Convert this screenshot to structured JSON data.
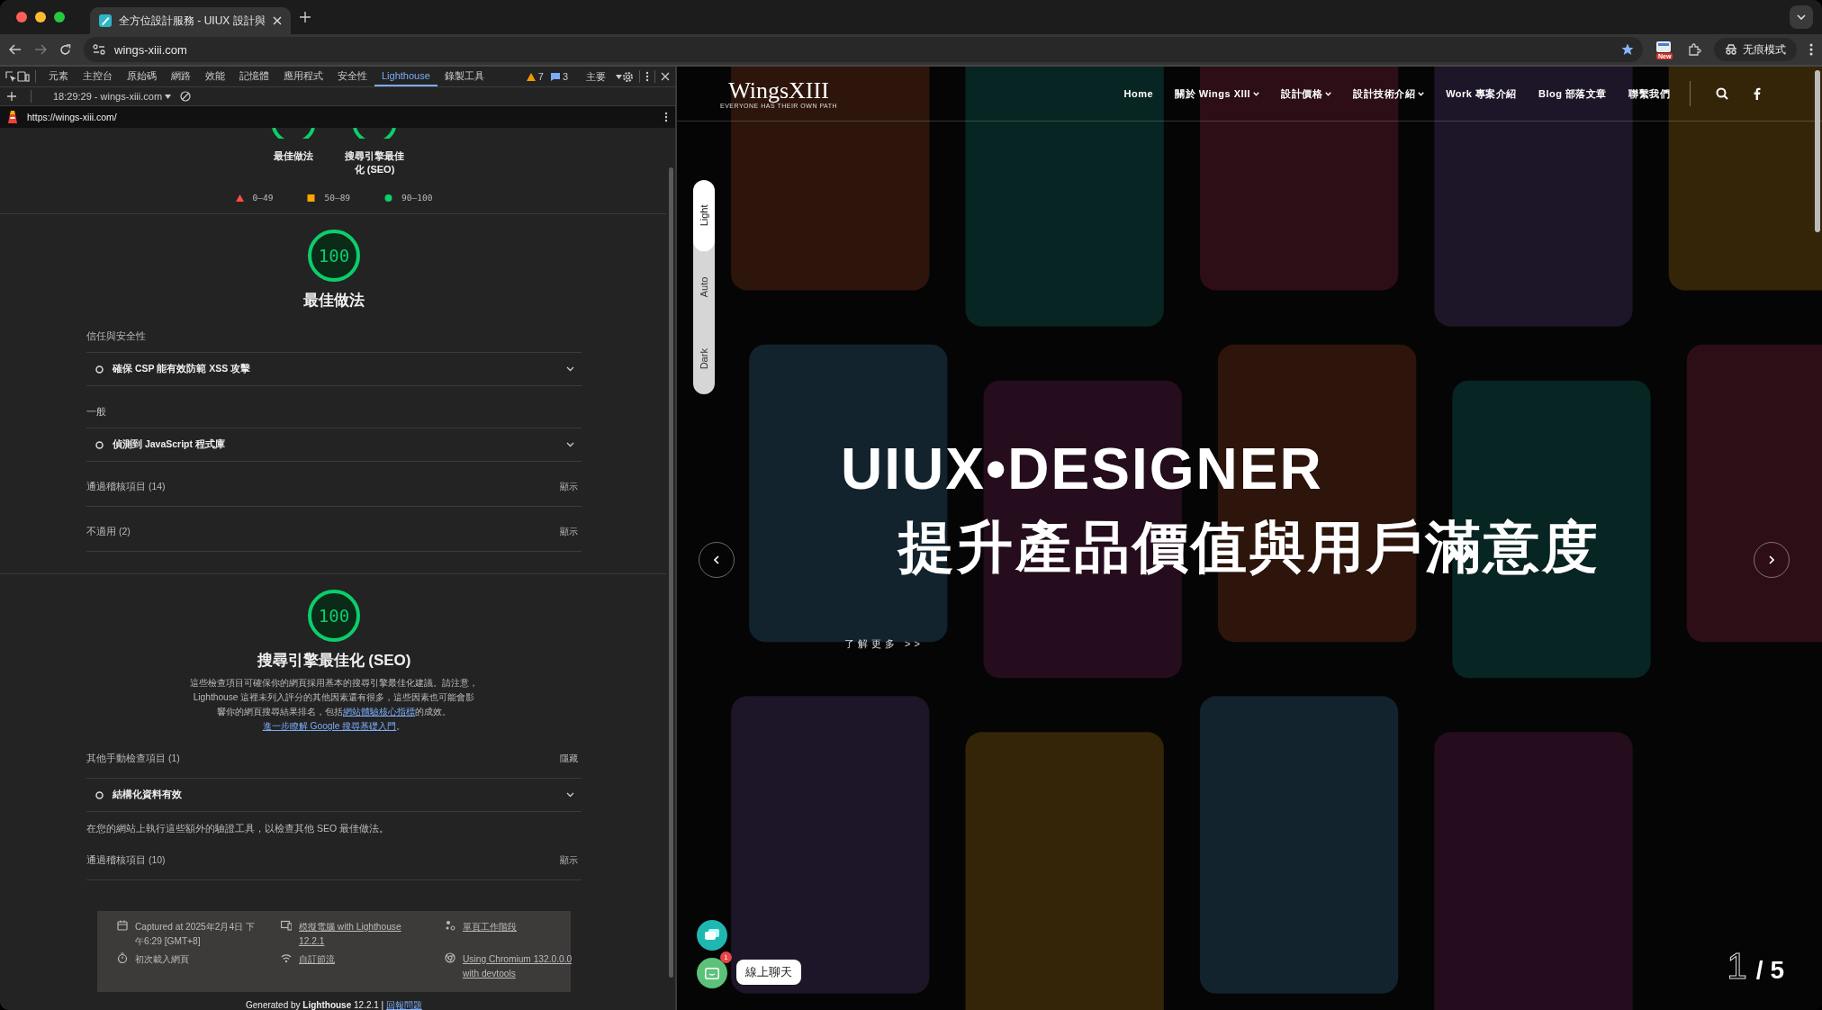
{
  "browser": {
    "tab": {
      "title": "全方位設計服務 - UIUX 設計與",
      "selected": true
    },
    "address": "wings-xiii.com",
    "extension_badge": "New",
    "profile": "无痕模式"
  },
  "devtools": {
    "tabs": [
      {
        "label": "元素",
        "selected": false
      },
      {
        "label": "主控台",
        "selected": false
      },
      {
        "label": "原始碼",
        "selected": false
      },
      {
        "label": "網路",
        "selected": false
      },
      {
        "label": "效能",
        "selected": false
      },
      {
        "label": "記憶體",
        "selected": false
      },
      {
        "label": "應用程式",
        "selected": false
      },
      {
        "label": "安全性",
        "selected": false
      },
      {
        "label": "Lighthouse",
        "selected": true
      },
      {
        "label": "錄製工具",
        "selected": false
      }
    ],
    "warnings": "7",
    "messages": "3",
    "context": "主要",
    "session": "18:29:29 - wings-xiii.com",
    "report_url": "https://wings-xiii.com/",
    "report": {
      "top_gauges": [
        {
          "label": "最佳做法"
        },
        {
          "label": "搜尋引擎最佳化 (SEO)"
        }
      ],
      "legend": [
        {
          "kind": "fail",
          "range": "0–49",
          "color": "#ff4e42"
        },
        {
          "kind": "average",
          "range": "50–89",
          "color": "#ffa400"
        },
        {
          "kind": "pass",
          "range": "90–100",
          "color": "#0cce6b"
        }
      ],
      "categories": [
        {
          "score": "100",
          "title": "最佳做法",
          "items": [
            {
              "kind": "group-title",
              "text": "信任與安全性"
            },
            {
              "kind": "audit",
              "text": "確保 CSP 能有效防範 XSS 攻擊"
            },
            {
              "kind": "group-title",
              "text": "一般"
            },
            {
              "kind": "audit",
              "text": "偵測到 JavaScript 程式庫"
            },
            {
              "kind": "toggle",
              "text": "通過稽核項目 (14)",
              "action": "顯示"
            },
            {
              "kind": "toggle",
              "text": "不適用 (2)",
              "action": "顯示"
            }
          ]
        },
        {
          "score": "100",
          "title": "搜尋引擎最佳化 (SEO)",
          "description": [
            {
              "text": "這些檢查項目可確保你的網頁採用基本的搜尋引擎最佳化建議。請注意，Lighthouse 這裡未列入評分的其他因素還有很多，這些因素也可能會影響你的網頁搜尋結果排名，包括"
            },
            {
              "text": "網站體驗核心指標",
              "link": true
            },
            {
              "text": "的成效。"
            },
            {
              "text": "進一步瞭解 Google 搜尋基礎入門",
              "link": true
            },
            {
              "text": "。"
            }
          ],
          "items": [
            {
              "kind": "toggle",
              "text": "其他手動檢查項目 (1)",
              "action": "隱藏"
            },
            {
              "kind": "audit",
              "text": "結構化資料有效"
            },
            {
              "kind": "note",
              "text": "在您的網站上執行這些額外的驗證工具，以檢查其他 SEO 最佳做法。"
            },
            {
              "kind": "toggle",
              "text": "通過稽核項目 (10)",
              "action": "顯示"
            }
          ]
        }
      ],
      "environment": [
        {
          "text": "Captured at 2025年2月4日 下午6:29 [GMT+8]",
          "link": false
        },
        {
          "text": "模擬電腦 with Lighthouse 12.2.1",
          "link": true
        },
        {
          "text": "單頁工作階段",
          "link": true
        },
        {
          "text": "初次載入網頁",
          "link": false
        },
        {
          "text": "自訂節流",
          "link": true
        },
        {
          "text": "Using Chromium 132.0.0.0 with devtools",
          "link": true
        }
      ],
      "generated": [
        {
          "text": "Generated by **Lighthouse** 12.2.1 | "
        },
        {
          "text": "回報問題",
          "link": true
        }
      ]
    }
  },
  "page": {
    "logo": {
      "name": "WingsXIII",
      "tagline": "EVERYONE HAS THEIR OWN PATH"
    },
    "nav": [
      {
        "label": "Home",
        "dropdown": false
      },
      {
        "label": "關於 Wings XIII",
        "dropdown": true
      },
      {
        "label": "設計價格",
        "dropdown": true
      },
      {
        "label": "設計技術介紹",
        "dropdown": true
      },
      {
        "label": "Work 專案介紹",
        "dropdown": false
      },
      {
        "label": "Blog 部落文章",
        "dropdown": false
      },
      {
        "label": "聯繫我們",
        "dropdown": false
      }
    ],
    "theme_modes": [
      {
        "label": "Light",
        "selected": true
      },
      {
        "label": "Auto",
        "selected": false
      },
      {
        "label": "Dark",
        "selected": false
      }
    ],
    "hero": {
      "kind": "picture",
      "headline": "UIUX•DESIGNER",
      "subheadline": "提升產品價值與用戶滿意度",
      "link": "了解更多 >>"
    },
    "pager": {
      "current": "1",
      "total": "/ 5"
    },
    "chat": {
      "badge": "1",
      "label": "線上聊天"
    }
  }
}
